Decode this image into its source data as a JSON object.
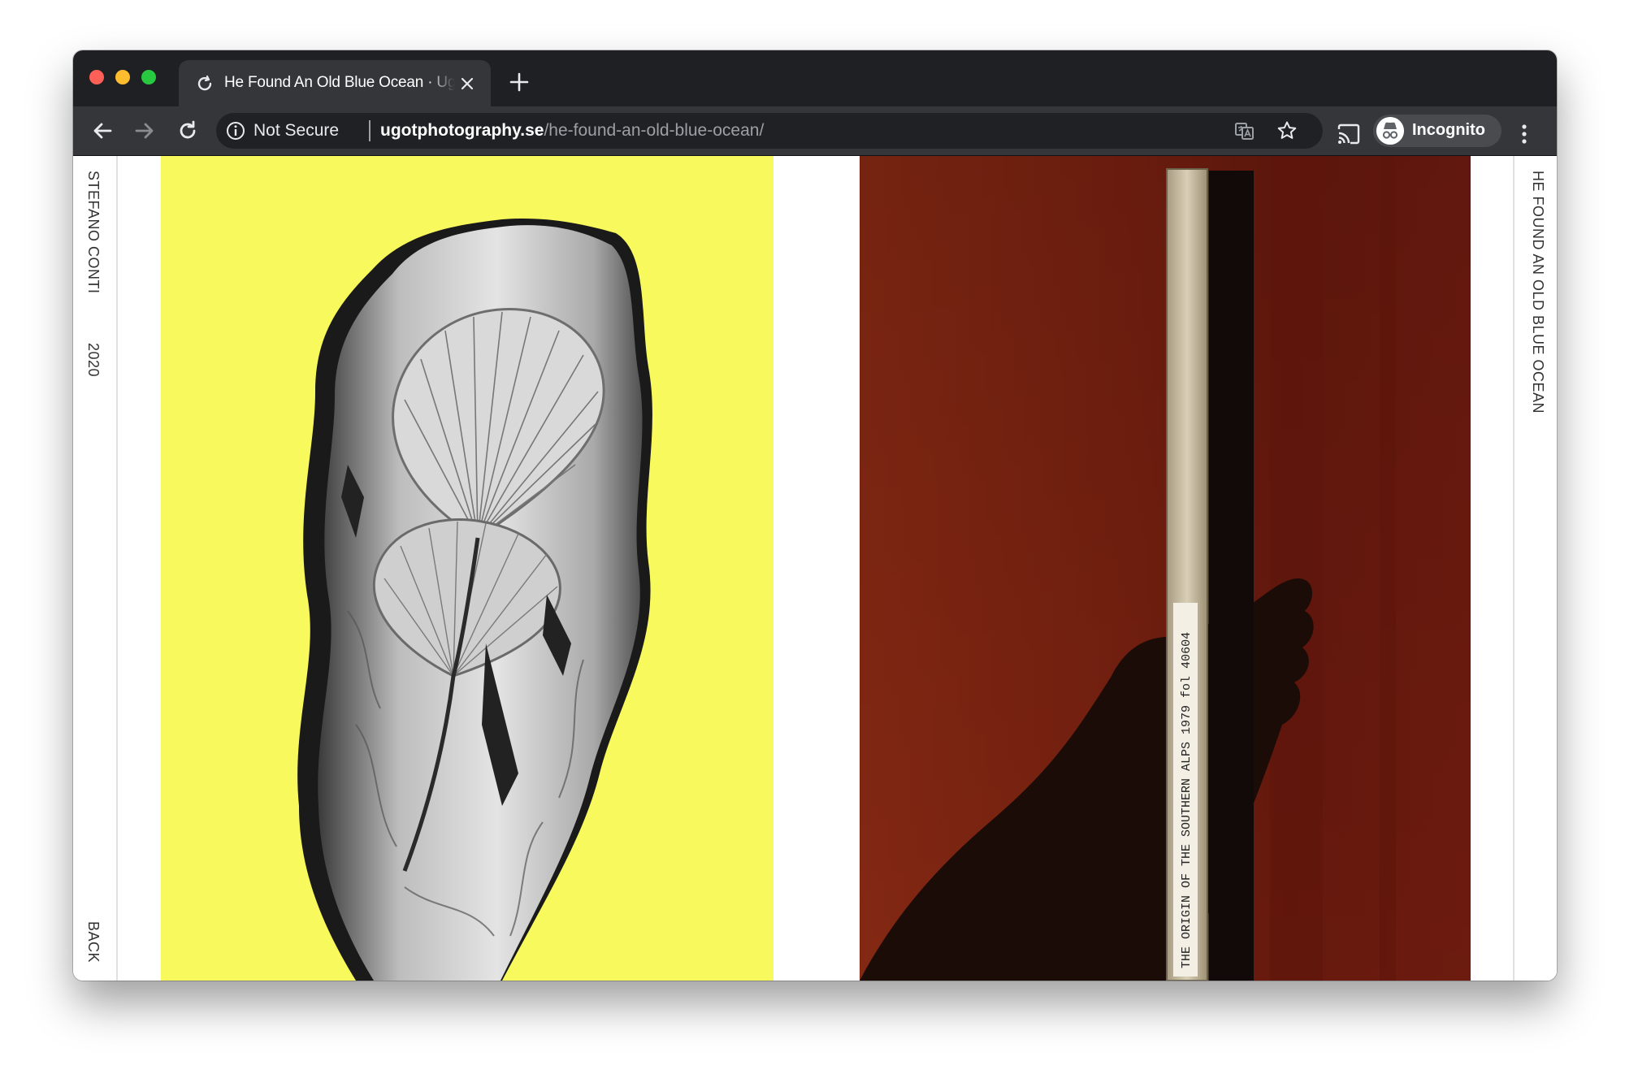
{
  "browser": {
    "tab": {
      "title": "He Found An Old Blue Ocean · Ugot",
      "loading": true
    },
    "address_bar": {
      "security_label": "Not Secure",
      "host": "ugotphotography.se",
      "path": "/he-found-an-old-blue-ocean/"
    },
    "profile": {
      "label": "Incognito"
    }
  },
  "page": {
    "sidebar_left": {
      "artist": "STEFANO CONTI",
      "year": "2020",
      "back_link": "BACK"
    },
    "sidebar_right": {
      "title": "HE FOUND AN OLD BLUE OCEAN"
    },
    "photos": [
      {
        "subject": "black and white fossil of leaf imprints on yellow background"
      },
      {
        "subject": "hand holding a book spine against red background",
        "spine_text": "THE ORIGIN OF THE SOUTHERN ALPS  1979    fol 40604"
      }
    ]
  },
  "colors": {
    "titlebar": "#1f2023",
    "toolbar": "#35363a",
    "yellow_background": "#f8f95c",
    "red_background": "#7a2110"
  }
}
